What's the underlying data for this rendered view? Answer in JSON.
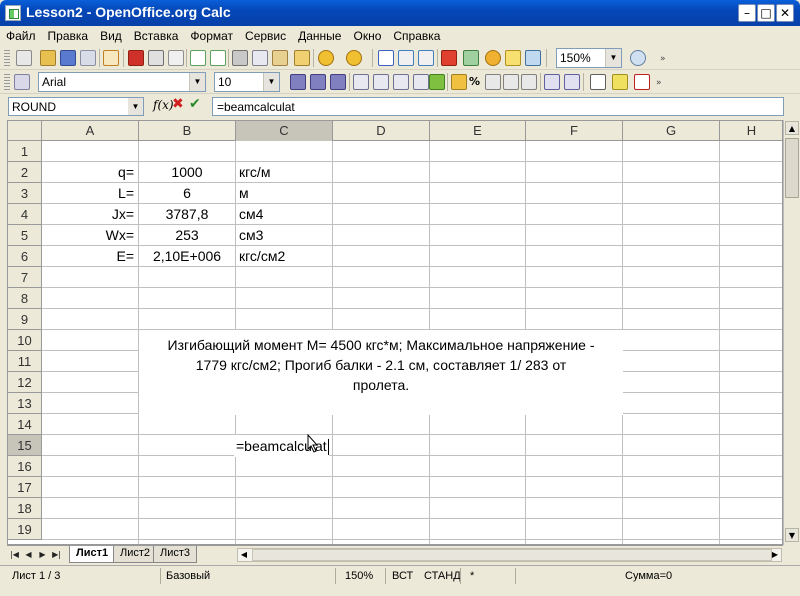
{
  "window": {
    "title": "Lesson2 - OpenOffice.org Calc"
  },
  "menu": [
    "Файл",
    "Правка",
    "Вид",
    "Вставка",
    "Формат",
    "Сервис",
    "Данные",
    "Окно",
    "Справка"
  ],
  "toolbar": {
    "zoom": "150%"
  },
  "format_bar": {
    "font": "Arial",
    "size": "10"
  },
  "formula_bar": {
    "name_box": "ROUND",
    "fx_symbol": "f(x)",
    "formula": "=beamcalculat"
  },
  "columns": [
    "A",
    "B",
    "C",
    "D",
    "E",
    "F",
    "G",
    "H"
  ],
  "rows": [
    "1",
    "2",
    "3",
    "4",
    "5",
    "6",
    "7",
    "8",
    "9",
    "10",
    "11",
    "12",
    "13",
    "14",
    "15",
    "16",
    "17",
    "18",
    "19"
  ],
  "cells": {
    "a2": "q=",
    "b2": "1000",
    "c2": "кгс/м",
    "a3": "L=",
    "b3": "6",
    "c3": "м",
    "a4": "Jx=",
    "b4": "3787,8",
    "c4": "см4",
    "a5": "Wx=",
    "b5": "253",
    "c5": "см3",
    "a6": "E=",
    "b6": "2,10E+006",
    "c6": "кгс/см2"
  },
  "result": {
    "line1": "Изгибающий момент М=  4500 кгс*м; Максимальное напряжение -",
    "line2": "1779 кгс/см2; Прогиб балки -  2.1 см, составляет 1/ 283 от",
    "line3": "пролета."
  },
  "edit_cell": {
    "text": "=beamcalculat"
  },
  "sheet_tabs": [
    "Лист1",
    "Лист2",
    "Лист3"
  ],
  "status": {
    "sheet": "Лист 1 / 3",
    "style": "Базовый",
    "zoom": "150%",
    "ins": "ВСТ",
    "mode": "СТАНД",
    "star": "*",
    "sum": "Сумма=0"
  }
}
